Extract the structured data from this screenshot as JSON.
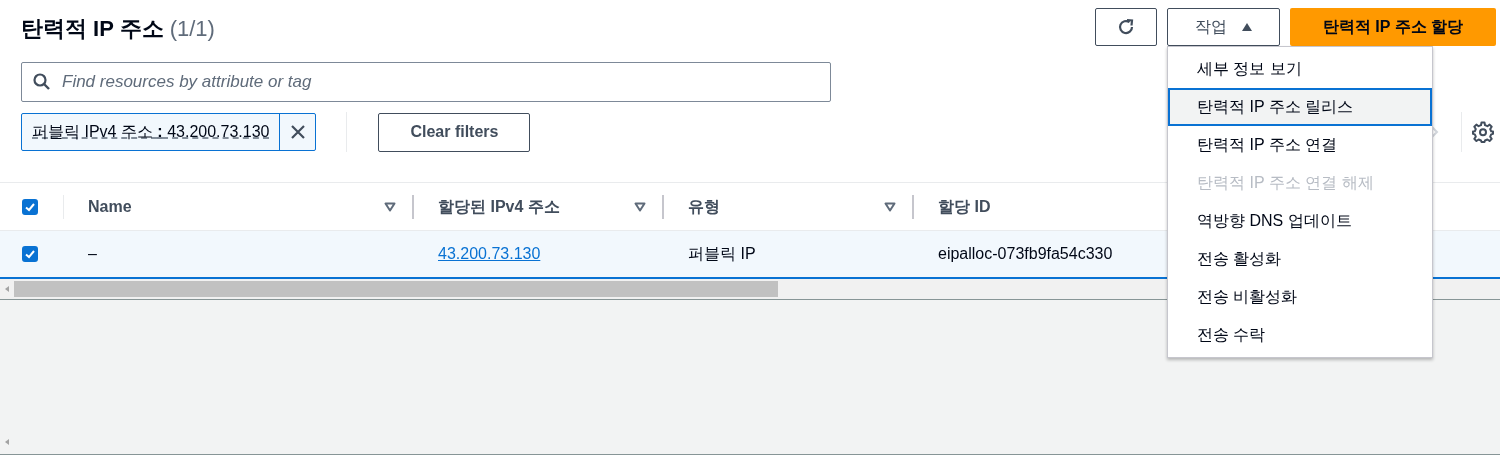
{
  "header": {
    "title": "탄력적 IP 주소",
    "count": "(1/1)"
  },
  "actions_button": {
    "label": "작업",
    "expanded": true
  },
  "primary_button": {
    "label": "탄력적 IP 주소 할당"
  },
  "search": {
    "placeholder": "Find resources by attribute or tag"
  },
  "filter_token": {
    "property": "퍼블릭 IPv4 주소",
    "separator": ":",
    "value": "43.200.73.130"
  },
  "clear_filters": {
    "label": "Clear filters"
  },
  "table": {
    "select_all_checked": true,
    "columns": [
      {
        "label": "Name"
      },
      {
        "label": "할당된 IPv4 주소"
      },
      {
        "label": "유형"
      },
      {
        "label": "할당 ID"
      }
    ],
    "rows": [
      {
        "selected": true,
        "cells": [
          {
            "text": "–",
            "kind": "text"
          },
          {
            "text": "43.200.73.130",
            "kind": "link"
          },
          {
            "text": "퍼블릭 IP",
            "kind": "text"
          },
          {
            "text": "eipalloc-073fb9fa54c330",
            "kind": "text"
          }
        ]
      }
    ]
  },
  "menu": {
    "items": [
      {
        "label": "세부 정보 보기",
        "disabled": false,
        "highlighted": false
      },
      {
        "label": "탄력적 IP 주소 릴리스",
        "disabled": false,
        "highlighted": true
      },
      {
        "label": "탄력적 IP 주소 연결",
        "disabled": false,
        "highlighted": false
      },
      {
        "label": "탄력적 IP 주소 연결 해제",
        "disabled": true,
        "highlighted": false
      },
      {
        "label": "역방향 DNS 업데이트",
        "disabled": false,
        "highlighted": false
      },
      {
        "label": "전송 활성화",
        "disabled": false,
        "highlighted": false
      },
      {
        "label": "전송 비활성화",
        "disabled": false,
        "highlighted": false
      },
      {
        "label": "전송 수락",
        "disabled": false,
        "highlighted": false
      }
    ]
  }
}
